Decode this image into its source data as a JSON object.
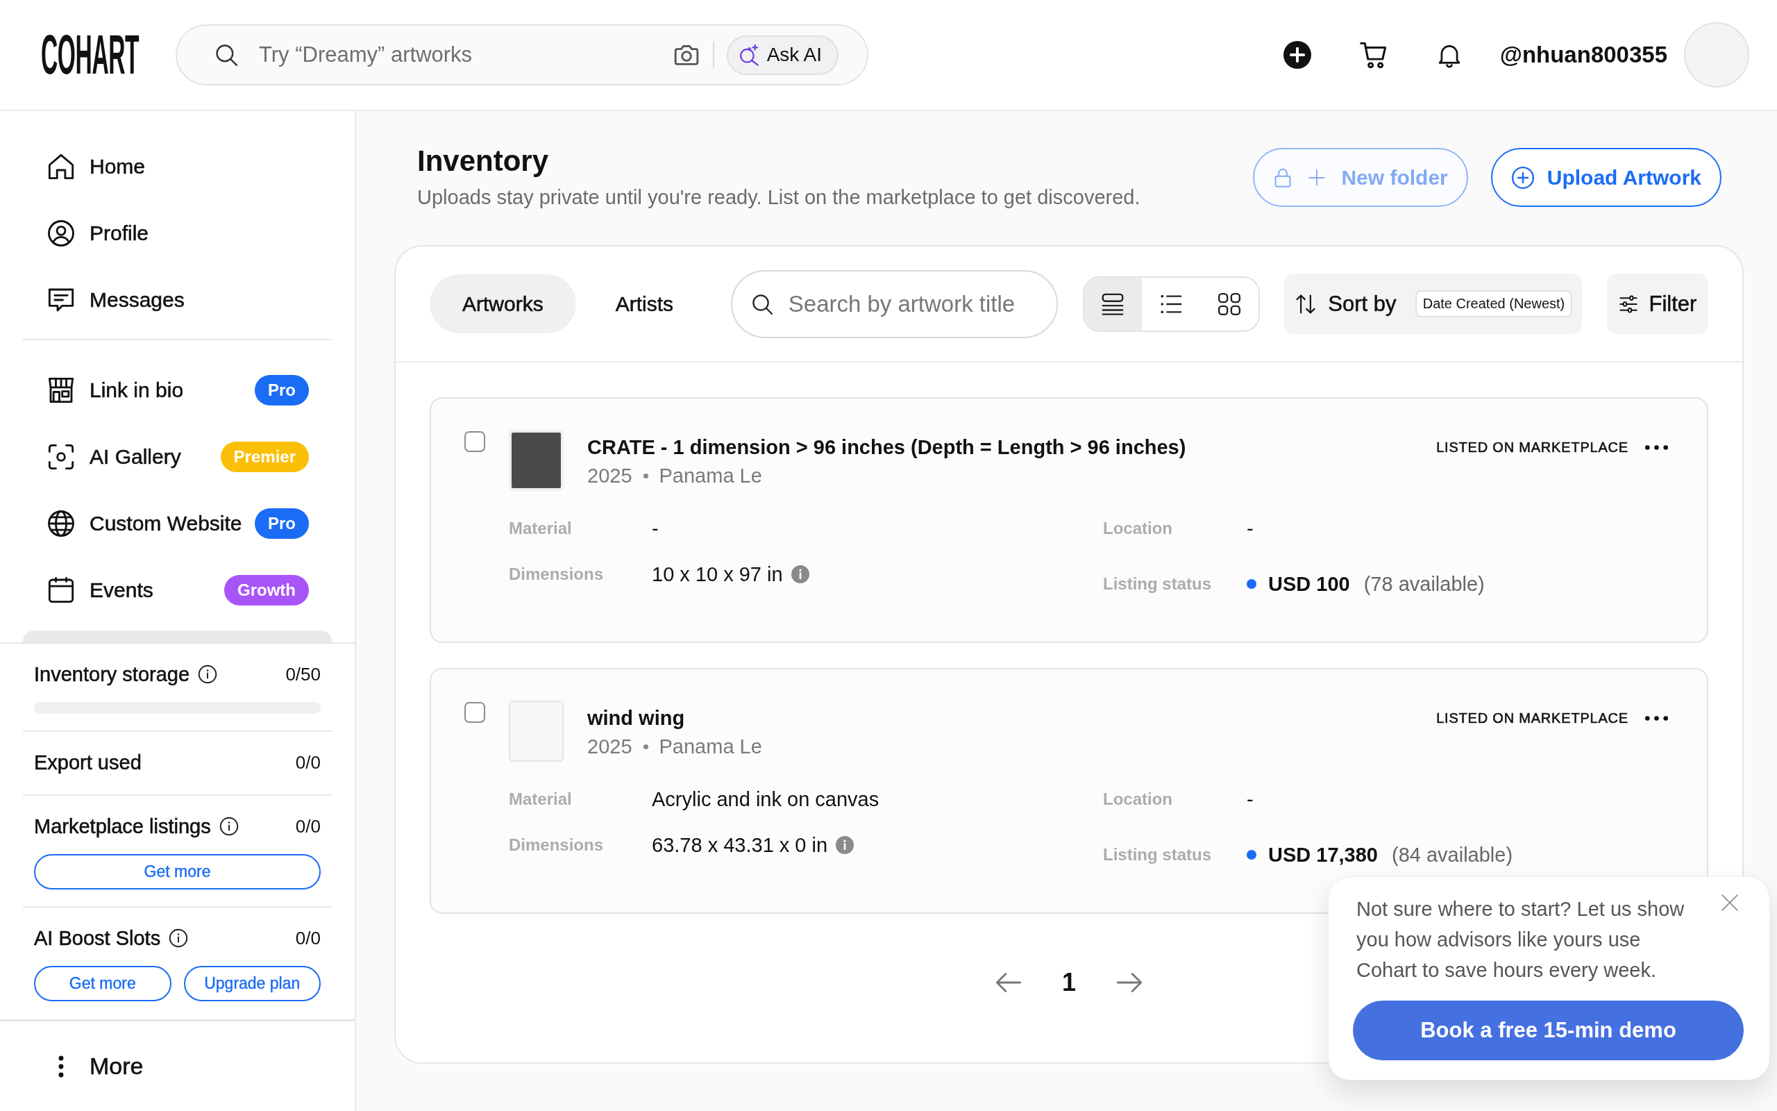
{
  "header": {
    "logo": "COHART",
    "search": {
      "placeholder": "Try “Dreamy” artworks",
      "ai_button": "Ask AI"
    },
    "username": "@nhuan800355"
  },
  "sidebar": {
    "groups": [
      {
        "items": [
          {
            "label": "Home"
          },
          {
            "label": "Profile"
          },
          {
            "label": "Messages"
          }
        ]
      },
      {
        "items": [
          {
            "label": "Link in bio",
            "badge": {
              "text": "Pro",
              "color": "#1a6cf5"
            }
          },
          {
            "label": "AI Gallery",
            "badge": {
              "text": "Premier",
              "color": "#fbbf08"
            }
          },
          {
            "label": "Custom Website",
            "badge": {
              "text": "Pro",
              "color": "#1a6cf5"
            }
          },
          {
            "label": "Events",
            "badge": {
              "text": "Growth",
              "color": "#a855f7"
            }
          }
        ]
      }
    ],
    "usage": [
      {
        "label": "Inventory storage",
        "info": true,
        "value": "0/50",
        "level": 0
      },
      {
        "label": "Export used",
        "info": false,
        "value": "0/0"
      },
      {
        "label": "Marketplace listings",
        "info": true,
        "value": "0/0",
        "buttons": [
          "Get more"
        ]
      },
      {
        "label": "AI Boost Slots",
        "info": true,
        "value": "0/0",
        "buttons": [
          "Get more",
          "Upgrade plan"
        ]
      }
    ],
    "more": "More"
  },
  "page": {
    "title": "Inventory",
    "subtitle": "Uploads stay private until you're ready. List on the marketplace to get discovered.",
    "actions": [
      {
        "label": "New folder",
        "locked": true
      },
      {
        "label": "Upload Artwork",
        "locked": false
      }
    ]
  },
  "toolbar": {
    "tabs": [
      {
        "label": "Artworks",
        "selected": true
      },
      {
        "label": "Artists",
        "selected": false
      }
    ],
    "search": {
      "placeholder": "Search by artwork title"
    },
    "view_modes": [
      {
        "selected": true
      },
      {
        "selected": false
      },
      {
        "selected": false
      }
    ],
    "sort": {
      "label": "Sort by",
      "value": "Date Created (Newest)"
    },
    "filter": "Filter"
  },
  "artworks": [
    {
      "checked": false,
      "photo": true,
      "title": "CRATE - 1 dimension > 96 inches (Depth = Length > 96 inches)",
      "year": "2025",
      "artist": "Panama Le",
      "status": "LISTED ON MARKETPLACE",
      "details": [
        {
          "kind": "text",
          "label": "Material",
          "value": "-",
          "info": false
        },
        {
          "kind": "text",
          "label": "Location",
          "value": "-",
          "info": false
        },
        {
          "kind": "text",
          "label": "Dimensions",
          "value": "10 x 10 x 97 in",
          "info": true
        },
        {
          "kind": "listing",
          "label": "Listing status",
          "price": "USD 100",
          "availability": "(78 available)",
          "color": "#1a6cf5",
          "info": false
        }
      ]
    },
    {
      "checked": false,
      "photo": false,
      "title": "wind wing",
      "year": "2025",
      "artist": "Panama Le",
      "status": "LISTED ON MARKETPLACE",
      "details": [
        {
          "kind": "text",
          "label": "Material",
          "value": "Acrylic and ink on canvas",
          "info": false
        },
        {
          "kind": "text",
          "label": "Location",
          "value": "-",
          "info": false
        },
        {
          "kind": "text",
          "label": "Dimensions",
          "value": "63.78 x 43.31 x 0 in",
          "info": true
        },
        {
          "kind": "listing",
          "label": "Listing status",
          "price": "USD 17,380",
          "availability": "(84 available)",
          "color": "#1a6cf5",
          "info": false
        }
      ]
    }
  ],
  "pagination": {
    "pages": [
      {
        "label": "1",
        "selected": true
      }
    ]
  },
  "popup": {
    "message": "Not sure where to start? Let us show you how advisors like yours use Cohart to save hours every week.",
    "button": "Book a free 15-min demo"
  }
}
